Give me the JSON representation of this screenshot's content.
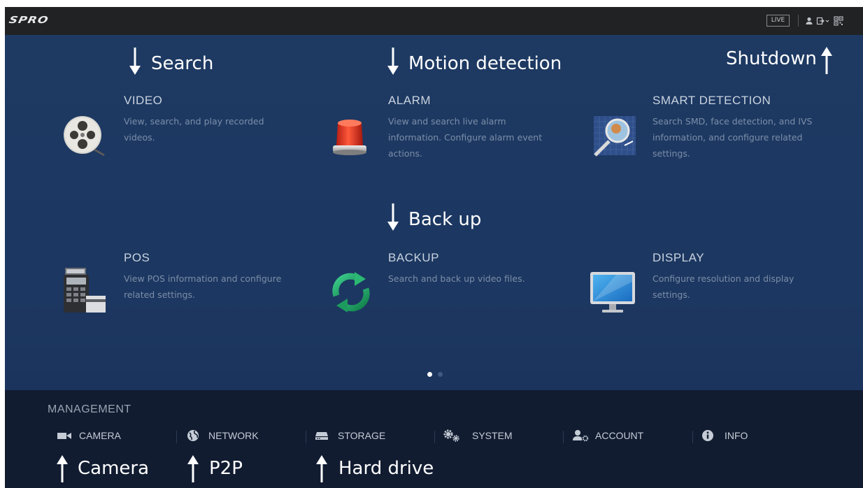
{
  "topbar": {
    "logo": "SPRO",
    "live_label": "LIVE",
    "icons": [
      "user-icon",
      "logout-icon",
      "qr-code-icon"
    ]
  },
  "annotations": {
    "search": "Search",
    "motion_detection": "Motion detection",
    "shutdown": "Shutdown",
    "back_up": "Back up",
    "camera": "Camera",
    "p2p": "P2P",
    "hard_drive": "Hard drive"
  },
  "tiles": [
    {
      "title": "VIDEO",
      "desc": "View, search, and play recorded videos.",
      "icon": "film-reel-icon"
    },
    {
      "title": "ALARM",
      "desc": "View and search live alarm information. Configure alarm event actions.",
      "icon": "alarm-beacon-icon"
    },
    {
      "title": "SMART DETECTION",
      "desc": "Search SMD, face detection, and IVS information, and configure related settings.",
      "icon": "magnifier-icon"
    },
    {
      "title": "POS",
      "desc": "View POS information and configure related settings.",
      "icon": "pos-terminal-icon"
    },
    {
      "title": "BACKUP",
      "desc": "Search and back up video files.",
      "icon": "backup-sync-icon"
    },
    {
      "title": "DISPLAY",
      "desc": "Configure resolution and display settings.",
      "icon": "monitor-icon"
    }
  ],
  "pagination": {
    "current": 1,
    "total": 2
  },
  "management": {
    "title": "MANAGEMENT",
    "items": [
      {
        "label": "CAMERA",
        "icon": "camera-icon"
      },
      {
        "label": "NETWORK",
        "icon": "network-globe-icon"
      },
      {
        "label": "STORAGE",
        "icon": "storage-drive-icon"
      },
      {
        "label": "SYSTEM",
        "icon": "gears-icon"
      },
      {
        "label": "ACCOUNT",
        "icon": "account-icon"
      },
      {
        "label": "INFO",
        "icon": "info-icon"
      }
    ]
  },
  "colors": {
    "background": "#1e3a63",
    "topbar": "#202224",
    "management_bar": "#111c31",
    "tile_title": "#c9d3df",
    "tile_desc": "#7c8ea8",
    "dot_active": "#ffffff",
    "dot_inactive": "#3e5a80"
  }
}
